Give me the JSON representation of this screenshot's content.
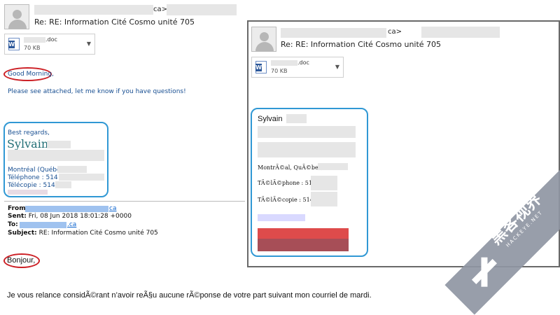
{
  "left_email": {
    "from_suffix": "ca>",
    "subject": "Re: RE: Information Cité Cosmo unité 705",
    "attachment": {
      "ext": ".doc",
      "size": "70 KB"
    },
    "greeting": "Good Morning,",
    "body_line": "Please see attached, let me know if you have questions!",
    "signature": {
      "regards": "Best regards,",
      "name": "Sylvain",
      "city": "Montréal (Québec)",
      "phone": "Téléphone : 514",
      "fax": "Télécopie : 514"
    },
    "quoted": {
      "from_label": "From:",
      "from_value": "ca",
      "sent_label": "Sent:",
      "sent_value": "Fri, 08 Jun 2018 18:01:28 +0000",
      "to_label": "To:",
      "to_value": ".ca",
      "subject_label": "Subject:",
      "subject_value": "RE: Information Cité Cosmo unité 705"
    },
    "bonjour": "Bonjour,",
    "relance": "Je vous relance considÃ©rant n’avoir reÃ§u aucune rÃ©ponse de votre part suivant mon courriel de mardi."
  },
  "right_email": {
    "from_suffix": "ca>",
    "subject": "Re: RE: Information Cité Cosmo unité 705",
    "attachment": {
      "ext": ".doc",
      "size": "70 KB"
    },
    "signature": {
      "name": "Sylvain",
      "city": "MontrÃ©al, QuÃ©bec,",
      "phone": "TÃ©lÃ©phone : 514",
      "fax": "TÃ©lÃ©copie : 514"
    }
  },
  "watermark": {
    "brand": "黑客视界",
    "domain": "HACKEYE.NET"
  }
}
